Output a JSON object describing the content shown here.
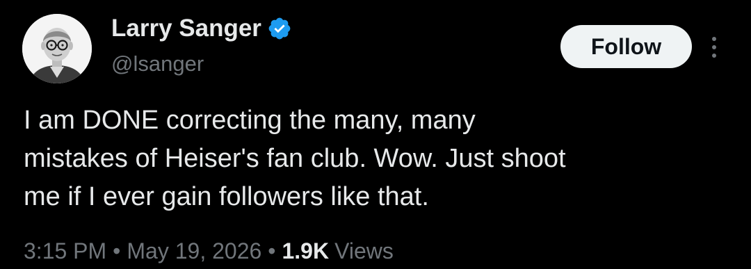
{
  "colors": {
    "background": "#000000",
    "text_primary": "#e7e9ea",
    "text_secondary": "#71767b",
    "verified_blue": "#1d9bf0",
    "follow_button_bg": "#eff3f4",
    "follow_button_text": "#0f1419"
  },
  "author": {
    "name": "Larry Sanger",
    "handle": "@lsanger",
    "verified": true,
    "verified_icon": "verified-badge-icon",
    "avatar": "avatar-portrait"
  },
  "actions": {
    "follow_label": "Follow",
    "more_icon": "more-vertical-icon"
  },
  "tweet": {
    "text": "I am DONE correcting the many, many\nmistakes of Heiser's fan club. Wow. Just shoot\nme if I ever gain followers like that."
  },
  "meta": {
    "time": "3:15 PM",
    "separator": "•",
    "date": "May 19, 2026",
    "views_count": "1.9K",
    "views_label": "Views"
  }
}
